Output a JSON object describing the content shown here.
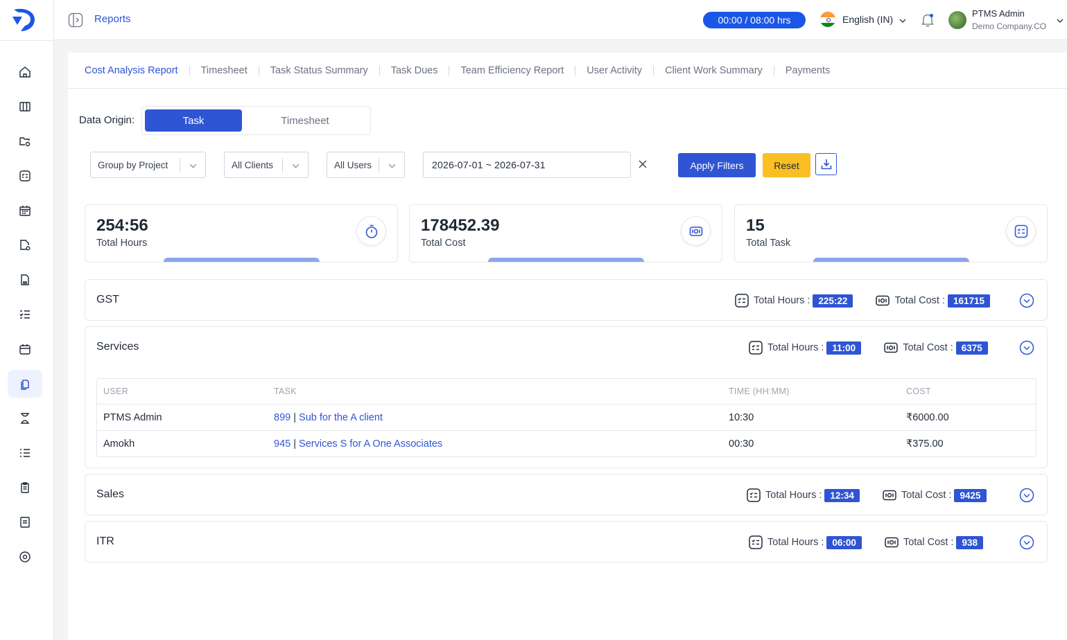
{
  "header": {
    "title": "Reports",
    "timer": "00:00 / 08:00 hrs",
    "language": "English (IN)",
    "user_name": "PTMS Admin",
    "user_company": "Demo Company.CO"
  },
  "sidebar": {
    "items": [
      {
        "icon": "home-icon"
      },
      {
        "icon": "columns-icon"
      },
      {
        "icon": "folder-settings-icon"
      },
      {
        "icon": "checklist-icon"
      },
      {
        "icon": "calendar-grid-icon"
      },
      {
        "icon": "document-settings-icon"
      },
      {
        "icon": "file-stack-icon"
      },
      {
        "icon": "task-list-icon"
      },
      {
        "icon": "calendar-icon"
      },
      {
        "icon": "reports-icon",
        "active": true
      },
      {
        "icon": "hourglass-icon"
      },
      {
        "icon": "list-icon"
      },
      {
        "icon": "clipboard-icon"
      },
      {
        "icon": "document-icon"
      },
      {
        "icon": "settings-circle-icon"
      }
    ]
  },
  "tabs": [
    "Cost Analysis Report",
    "Timesheet",
    "Task Status Summary",
    "Task Dues",
    "Team Efficiency Report",
    "User Activity",
    "Client Work Summary",
    "Payments"
  ],
  "filters": {
    "data_origin_label": "Data Origin:",
    "origin_options": [
      "Task",
      "Timesheet"
    ],
    "group_by": "Group by Project",
    "clients": "All Clients",
    "users": "All Users",
    "date_range": "2026-07-01 ~ 2026-07-31",
    "apply_label": "Apply Filters",
    "reset_label": "Reset"
  },
  "stats": [
    {
      "value": "254:56",
      "label": "Total Hours",
      "icon": "stopwatch-icon"
    },
    {
      "value": "178452.39",
      "label": "Total Cost",
      "icon": "money-icon"
    },
    {
      "value": "15",
      "label": "Total Task",
      "icon": "checklist-icon"
    }
  ],
  "groups": [
    {
      "name": "GST",
      "hours_label": "Total Hours :",
      "hours": "225:22",
      "cost_label": "Total Cost :",
      "cost": "161715"
    },
    {
      "name": "Services",
      "hours_label": "Total Hours :",
      "hours": "11:00",
      "cost_label": "Total Cost :",
      "cost": "6375"
    },
    {
      "name": "Sales",
      "hours_label": "Total Hours :",
      "hours": "12:34",
      "cost_label": "Total Cost :",
      "cost": "9425"
    },
    {
      "name": "ITR",
      "hours_label": "Total Hours :",
      "hours": "06:00",
      "cost_label": "Total Cost :",
      "cost": "938"
    }
  ],
  "services_table": {
    "columns": [
      "USER",
      "TASK",
      "TIME (HH:MM)",
      "COST"
    ],
    "rows": [
      {
        "user": "PTMS Admin",
        "task_id": "899",
        "task_sep": "|",
        "task_name": "Sub for the A client",
        "time": "10:30",
        "cost": "₹6000.00"
      },
      {
        "user": "Amokh",
        "task_id": "945",
        "task_sep": "|",
        "task_name": "Services S for A One Associates",
        "time": "00:30",
        "cost": "₹375.00"
      }
    ]
  },
  "colors": {
    "accent": "#2f55d4",
    "timer_bg": "#1a56e8",
    "reset": "#fbbf24"
  }
}
